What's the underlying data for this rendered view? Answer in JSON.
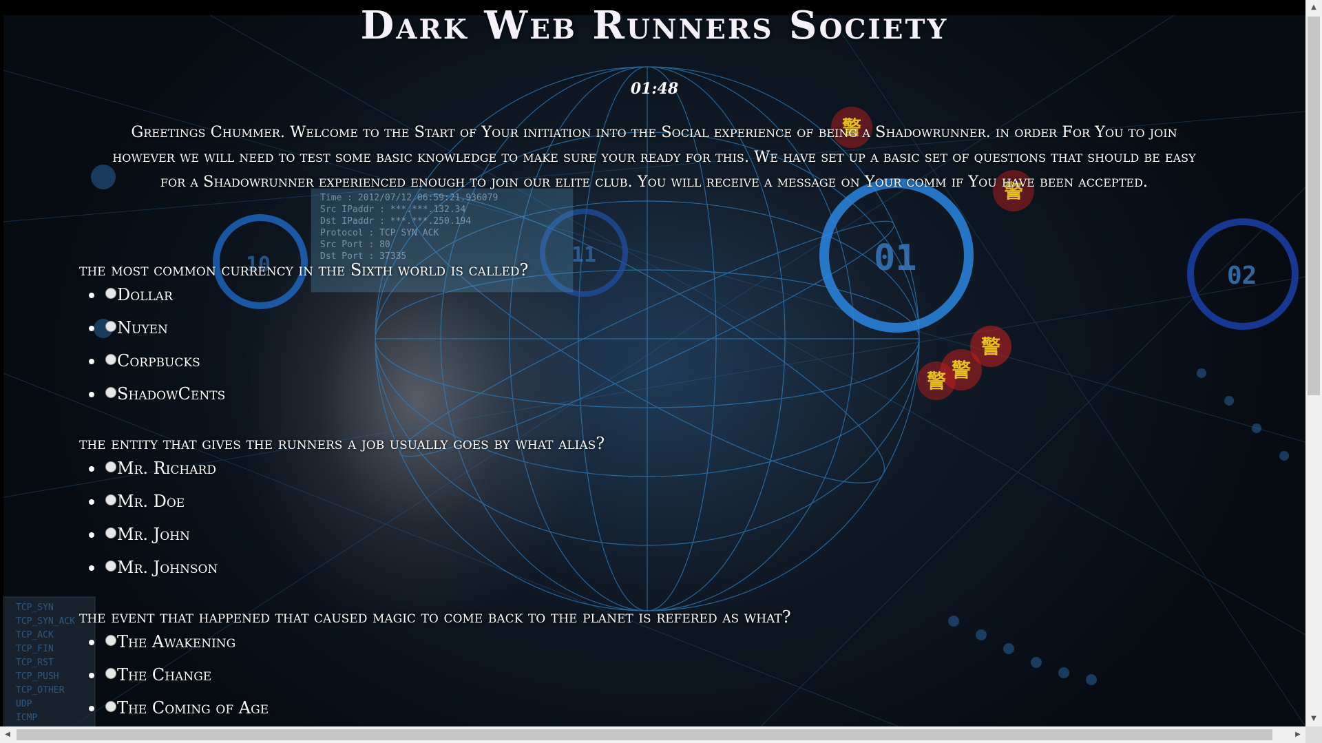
{
  "page": {
    "title": "Dark Web Runners Society",
    "timer": "01:48",
    "intro": "Greetings Chummer. Welcome to the Start of Your initiation into the Social experience of being a Shadowrunner. in order For You to join however we will need to test some basic knowledge to make sure your ready for this. We have set up a basic set of questions that should be easy for a Shadowrunner experienced enough to join our elite club. You will receive a message on Your comm if You have been accepted."
  },
  "questions": [
    {
      "text": "the most common currency in the Sixth world is called?",
      "options": [
        "Dollar",
        "Nuyen",
        "Corpbucks",
        "ShadowCents"
      ]
    },
    {
      "text": "the entity that gives the runners a job usually goes by what alias?",
      "options": [
        "Mr. Richard",
        "Mr. Doe",
        "Mr. John",
        "Mr. Johnson"
      ]
    },
    {
      "text": "the event that happened that caused magic to come back to the planet is refered as what?",
      "options": [
        "The Awakening",
        "The Change",
        "The Coming of Age"
      ]
    }
  ],
  "background": {
    "packet_panel": [
      "Time      : 2012/07/12 06:59:21.936079",
      "Src IPaddr  : ***.***.132.34",
      "Dst IPaddr  : ***.***.250.194",
      "Protocol    : TCP SYN ACK",
      "Src Port    : 80",
      "Dst Port    : 37335"
    ],
    "protocol_list": [
      "TCP_SYN",
      "TCP_SYN_ACK",
      "TCP_ACK",
      "TCP_FIN",
      "TCP_RST",
      "TCP_PUSH",
      "TCP_OTHER",
      "UDP",
      "ICMP"
    ],
    "ring_labels": [
      "10",
      "11",
      "01",
      "02"
    ],
    "alert_glyph": "警",
    "colors": {
      "background_dark": "#0e1722",
      "grid_blue": "#2f7fc0",
      "ring_blue": "#1f6fd0",
      "alert_red": "#c8201e",
      "text": "#ffffff"
    }
  }
}
